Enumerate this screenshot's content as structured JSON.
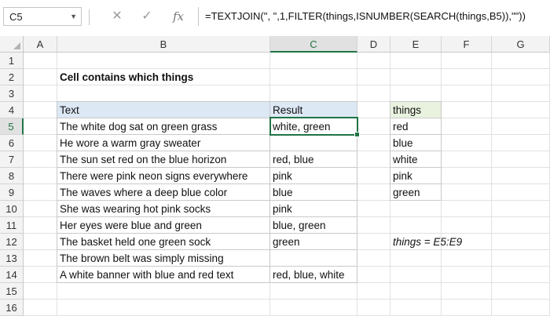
{
  "namebox": {
    "value": "C5"
  },
  "formula_bar": {
    "cancel_icon": "close-icon",
    "enter_icon": "check-icon",
    "fx_label": "fx",
    "formula": "=TEXTJOIN(\", \",1,FILTER(things,ISNUMBER(SEARCH(things,B5)),\"\"))"
  },
  "columns": [
    "A",
    "B",
    "C",
    "D",
    "E",
    "F",
    "G"
  ],
  "rows": [
    "1",
    "2",
    "3",
    "4",
    "5",
    "6",
    "7",
    "8",
    "9",
    "10",
    "11",
    "12",
    "13",
    "14",
    "15",
    "16"
  ],
  "active_cell": "C5",
  "title": "Cell contains which things",
  "table": {
    "headers": {
      "text": "Text",
      "result": "Result"
    },
    "rows": [
      {
        "text": "The white dog sat on green grass",
        "result": "white, green"
      },
      {
        "text": "He wore a warm gray sweater",
        "result": ""
      },
      {
        "text": "The sun set red on the blue horizon",
        "result": "red, blue"
      },
      {
        "text": "There were pink neon signs everywhere",
        "result": "pink"
      },
      {
        "text": "The waves where a deep blue color",
        "result": "blue"
      },
      {
        "text": "She was wearing hot pink socks",
        "result": "pink"
      },
      {
        "text": "Her eyes were blue and green",
        "result": "blue, green"
      },
      {
        "text": "The basket held one green sock",
        "result": "green"
      },
      {
        "text": "The brown belt was simply missing",
        "result": ""
      },
      {
        "text": "A white banner with blue and red text",
        "result": "red, blue, white"
      }
    ]
  },
  "things": {
    "header": "things",
    "items": [
      "red",
      "blue",
      "white",
      "pink",
      "green"
    ]
  },
  "named_range_note": "things = E5:E9",
  "colors": {
    "accent": "#217346",
    "table_header_fill": "#dde8f5",
    "things_header_fill": "#e9f2df"
  }
}
